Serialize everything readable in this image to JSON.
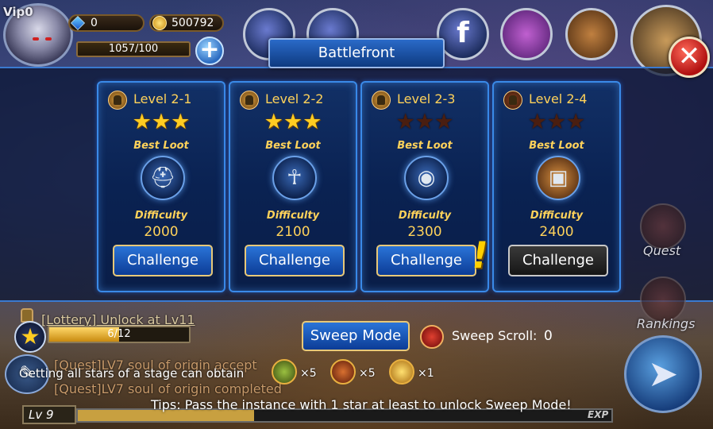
{
  "hud": {
    "vip": "Vip0",
    "gems": "0",
    "gold": "500792",
    "energy": "1057/100",
    "title": "Battlefront",
    "close": "✕"
  },
  "levels": [
    {
      "name": "Level 2-1",
      "stars": 3,
      "best_loot": "Best Loot",
      "loot_icon": "helmet-icon",
      "difficulty_label": "Difficulty",
      "difficulty": "2000",
      "button": "Challenge",
      "locked": false,
      "alert": false
    },
    {
      "name": "Level 2-2",
      "stars": 3,
      "best_loot": "Best Loot",
      "loot_icon": "amulet-icon",
      "difficulty_label": "Difficulty",
      "difficulty": "2100",
      "button": "Challenge",
      "locked": false,
      "alert": false
    },
    {
      "name": "Level 2-3",
      "stars": 0,
      "best_loot": "Best Loot",
      "loot_icon": "armor-icon",
      "difficulty_label": "Difficulty",
      "difficulty": "2300",
      "button": "Challenge",
      "locked": false,
      "alert": true
    },
    {
      "name": "Level 2-4",
      "stars": 0,
      "best_loot": "Best Loot",
      "loot_icon": "chest-armor-icon",
      "difficulty_label": "Difficulty",
      "difficulty": "2400",
      "button": "Challenge",
      "locked": true,
      "alert": false
    }
  ],
  "sweep": {
    "button": "Sweep Mode",
    "label": "Sweep Scroll:",
    "count": "0"
  },
  "stars_progress": {
    "text": "6/12",
    "fraction": 0.5
  },
  "feed": {
    "lottery": "[Lottery] Unlock at Lv11",
    "quest_accepted": "[Quest]LV7 soul of origin accept",
    "quest_completed": "[Quest]LV7 soul of origin completed",
    "hint": "Getting all stars of a stage can obtain"
  },
  "rewards": [
    {
      "icon": "herb-icon",
      "qty": "×5"
    },
    {
      "icon": "meat-icon",
      "qty": "×5"
    },
    {
      "icon": "gold-coin-icon",
      "qty": "×1"
    }
  ],
  "footer": {
    "level": "Lv 9",
    "exp_label": "EXP",
    "exp_fraction": 0.33,
    "tips": "Tips: Pass the instance with 1 star at least to unlock Sweep Mode!"
  },
  "side": {
    "quest": "Quest",
    "rankings": "Rankings"
  },
  "colors": {
    "accent_gold": "#ffd25a",
    "panel_border": "#3a8ae8",
    "close_red": "#c01010"
  }
}
